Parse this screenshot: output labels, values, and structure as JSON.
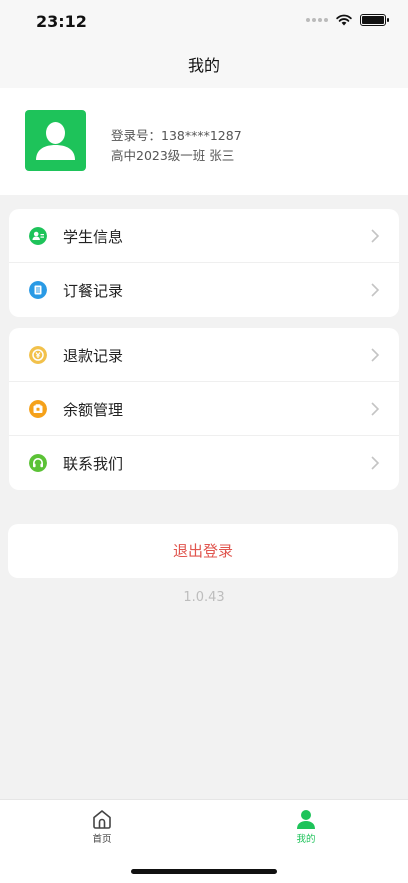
{
  "status_bar": {
    "time": "23:12",
    "battery_level": 1.0
  },
  "nav": {
    "title": "我的"
  },
  "profile": {
    "login_number": "登录号：138****1287",
    "class_name": "高中2023级一班 张三",
    "avatar_icon": "user-silhouette-icon",
    "avatar_color": "#1ec35a"
  },
  "menu": {
    "group1": [
      {
        "label": "学生信息",
        "icon": "student-info-icon",
        "color": "#1ec35a"
      },
      {
        "label": "订餐记录",
        "icon": "order-record-icon",
        "color": "#2a9ae5"
      }
    ],
    "group2": [
      {
        "label": "退款记录",
        "icon": "refund-icon",
        "color": "#f2c14b"
      },
      {
        "label": "余额管理",
        "icon": "balance-icon",
        "color": "#f5a11a"
      },
      {
        "label": "联系我们",
        "icon": "headset-icon",
        "color": "#5bc236"
      }
    ]
  },
  "logout": {
    "label": "退出登录",
    "color": "#e0554e"
  },
  "version": "1.0.43",
  "tabs": [
    {
      "label": "首页",
      "icon": "home-icon",
      "active": false
    },
    {
      "label": "我的",
      "icon": "profile-icon",
      "active": true,
      "color": "#1ec35a"
    }
  ]
}
